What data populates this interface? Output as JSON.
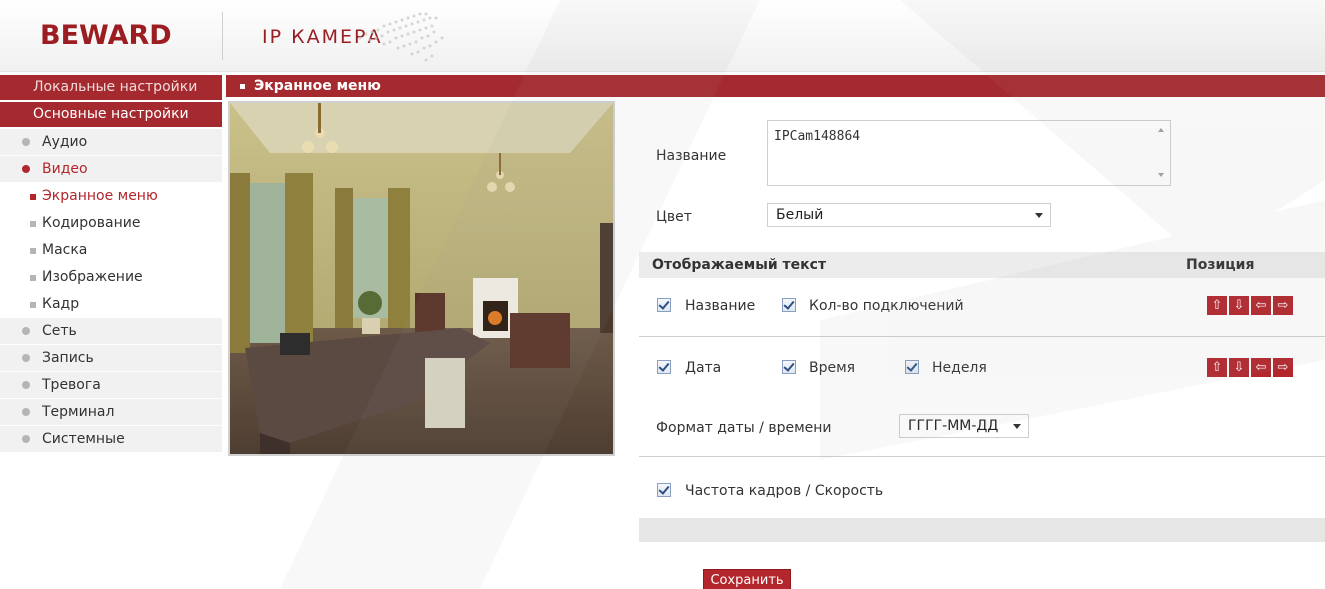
{
  "header": {
    "logo": "BEWARD",
    "product": "IP КАМЕРА"
  },
  "sidebar": {
    "local_settings": "Локальные настройки",
    "basic_settings": "Основные настройки",
    "items": [
      {
        "label": "Аудио"
      },
      {
        "label": "Видео"
      },
      {
        "label": "Экранное меню"
      },
      {
        "label": "Кодирование"
      },
      {
        "label": "Маска"
      },
      {
        "label": "Изображение"
      },
      {
        "label": "Кадр"
      },
      {
        "label": "Сеть"
      },
      {
        "label": "Запись"
      },
      {
        "label": "Тревога"
      },
      {
        "label": "Терминал"
      },
      {
        "label": "Системные"
      }
    ]
  },
  "main": {
    "title": "Экранное меню",
    "name_label": "Название",
    "name_value": "IPCam148864",
    "color_label": "Цвет",
    "color_value": "Белый",
    "display_text_header": "Отображаемый текст",
    "position_header": "Позиция",
    "cb_name": "Название",
    "cb_connections": "Кол-во подключений",
    "cb_date": "Дата",
    "cb_time": "Время",
    "cb_week": "Неделя",
    "date_format_label": "Формат даты / времени",
    "date_format_value": "ГГГГ-ММ-ДД",
    "cb_framerate": "Частота кадров / Скорость",
    "save": "Сохранить",
    "arrows": {
      "up": "⇧",
      "down": "⇩",
      "left": "⇦",
      "right": "⇨"
    }
  },
  "colors": {
    "brand": "#a52a2f",
    "active_text": "#b3262c"
  }
}
